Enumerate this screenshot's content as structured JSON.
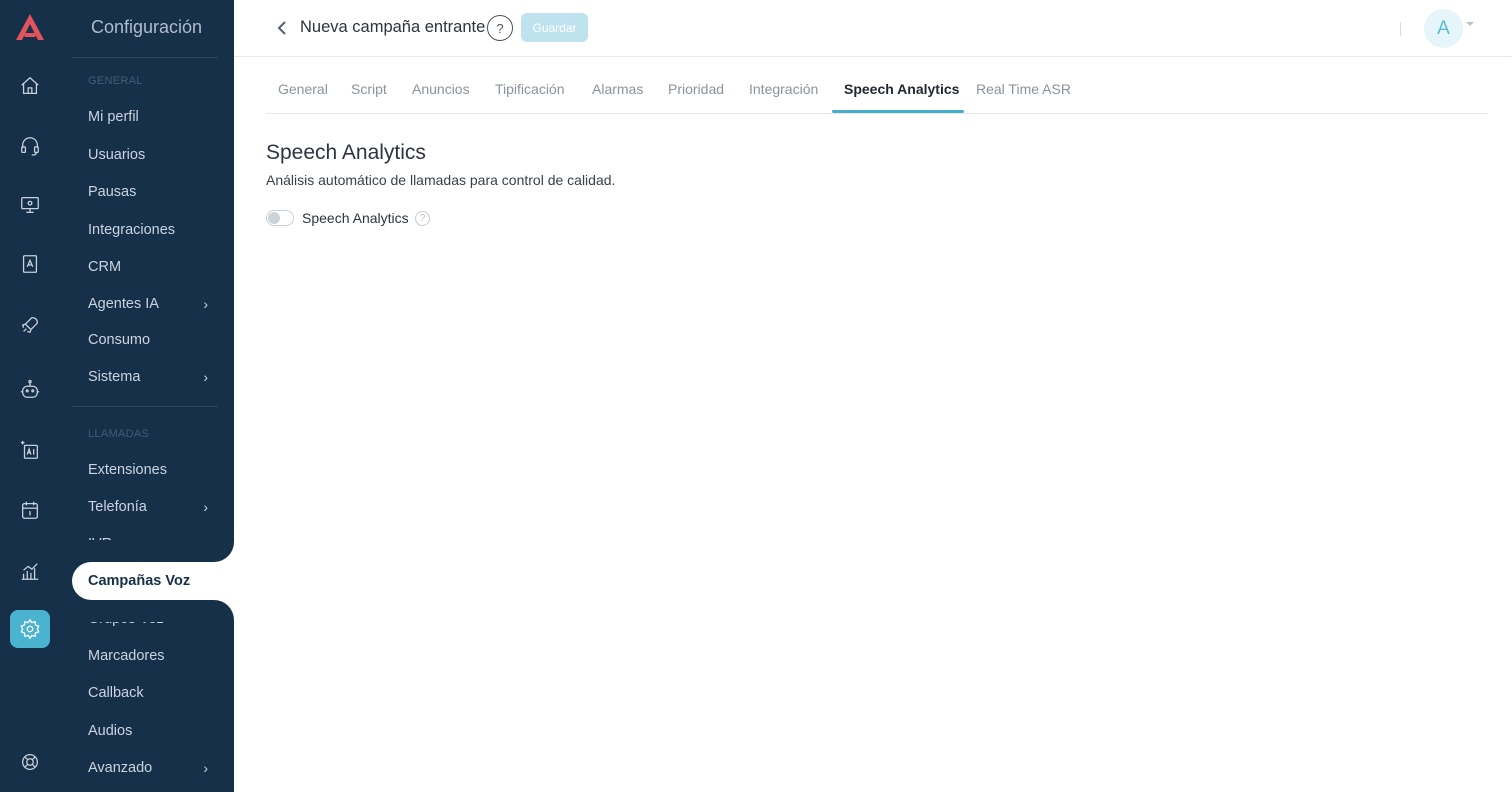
{
  "colors": {
    "sidebar_bg": "#17304a",
    "accent": "#46aecb",
    "save_disabled": "#bfe3ee"
  },
  "rail": {
    "logo_icon": "brand-logo-icon",
    "items": [
      {
        "icon": "home-icon"
      },
      {
        "icon": "headset-icon"
      },
      {
        "icon": "monitor-icon"
      },
      {
        "icon": "contacts-book-icon"
      },
      {
        "icon": "campaign-rocket-icon"
      },
      {
        "icon": "robot-icon"
      },
      {
        "icon": "ai-sparkle-icon"
      },
      {
        "icon": "calendar-icon"
      },
      {
        "icon": "analytics-chart-icon"
      },
      {
        "icon": "settings-gear-icon",
        "active": true
      },
      {
        "icon": "support-lifebuoy-icon"
      }
    ]
  },
  "sidebar": {
    "title": "Configuración",
    "sections": {
      "general": "GENERAL",
      "llamadas": "LLAMADAS"
    },
    "items": {
      "mi_perfil": "Mi perfil",
      "usuarios": "Usuarios",
      "pausas": "Pausas",
      "integraciones": "Integraciones",
      "crm": "CRM",
      "agentes_ia": "Agentes IA",
      "consumo": "Consumo",
      "sistema": "Sistema",
      "extensiones": "Extensiones",
      "telefonia": "Telefonía",
      "ivr": "IVR",
      "campanas_voz": "Campañas Voz",
      "grupos_voz": "Grupos Voz",
      "marcadores": "Marcadores",
      "callback": "Callback",
      "audios": "Audios",
      "avanzado": "Avanzado"
    },
    "chevron": "›"
  },
  "header": {
    "title": "Nueva campaña entrante",
    "help": "?",
    "save_label": "Guardar",
    "avatar_letter": "A"
  },
  "tabs": {
    "general": "General",
    "script": "Script",
    "anuncios": "Anuncios",
    "tipificacion": "Tipificación",
    "alarmas": "Alarmas",
    "prioridad": "Prioridad",
    "integracion": "Integración",
    "speech_analytics": "Speech Analytics",
    "real_time_asr": "Real Time ASR",
    "active": "Speech Analytics"
  },
  "content": {
    "title": "Speech Analytics",
    "description": "Análisis automático de llamadas para control de calidad.",
    "toggle_label": "Speech Analytics",
    "toggle_on": false,
    "info": "?"
  }
}
